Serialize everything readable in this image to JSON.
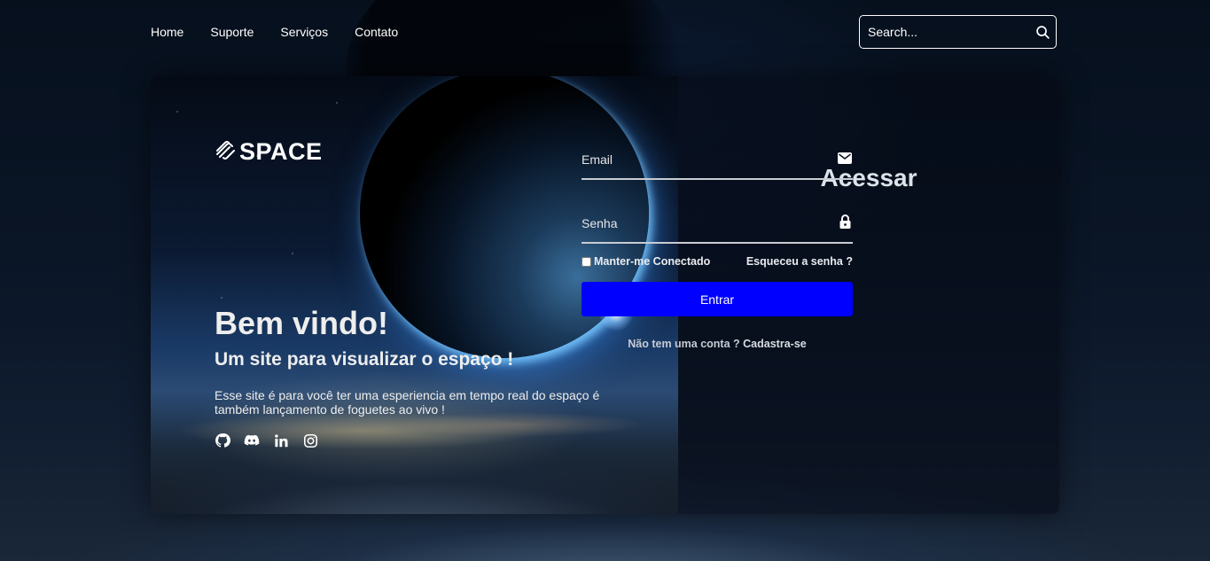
{
  "nav": {
    "links": [
      "Home",
      "Suporte",
      "Serviços",
      "Contato"
    ],
    "search": {
      "placeholder": "Search..."
    }
  },
  "brand": {
    "name": "SPACE"
  },
  "welcome": {
    "title": "Bem vindo!",
    "subtitle": "Um site para visualizar o espaço !",
    "description": "Esse site é para você ter uma esperiencia em tempo real do espaço é também lançamento de foguetes ao vivo !"
  },
  "social": {
    "icons": [
      "github-icon",
      "discord-icon",
      "linkedin-icon",
      "instagram-icon"
    ]
  },
  "login": {
    "title": "Acessar",
    "email_placeholder": "Email",
    "password_placeholder": "Senha",
    "remember_label": "Manter-me Conectado",
    "forgot_label": "Esqueceu a senha ?",
    "submit_label": "Entrar",
    "register_prompt": "Não tem uma conta ?",
    "register_link": "Cadastra-se"
  },
  "colors": {
    "primary_button": "#0000ff",
    "text": "#ffffff",
    "field_border": "#c9ccd2"
  }
}
